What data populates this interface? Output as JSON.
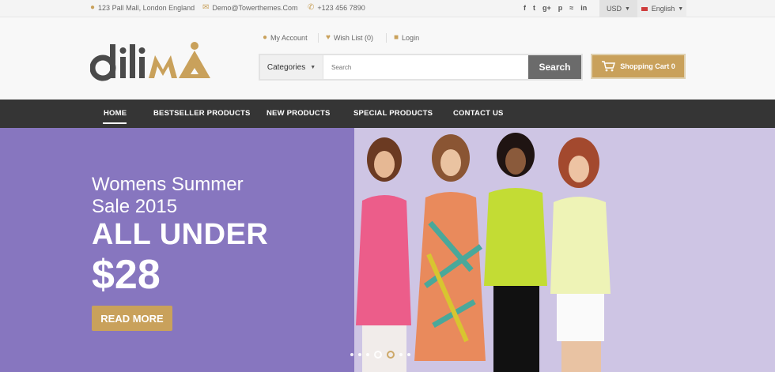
{
  "topbar": {
    "address": "123 Pall Mall, London England",
    "email": "Demo@Towerthemes.Com",
    "phone": "+123 456 7890",
    "social_icons": [
      {
        "icon": "facebook-icon",
        "glyph": "f"
      },
      {
        "icon": "twitter-icon",
        "glyph": "t"
      },
      {
        "icon": "google-plus-icon",
        "glyph": "g+"
      },
      {
        "icon": "pinterest-icon",
        "glyph": "p"
      },
      {
        "icon": "rss-icon",
        "glyph": "≈"
      },
      {
        "icon": "linkedin-icon",
        "glyph": "in"
      }
    ],
    "currency": "USD",
    "language": "English"
  },
  "header": {
    "logo_text": "diliMA",
    "my_account": "My Account",
    "wish_list": "Wish List (0)",
    "login": "Login",
    "categories_label": "Categories",
    "search_placeholder": "Search",
    "search_button": "Search",
    "cart_label": "Shopping Cart 0"
  },
  "nav": {
    "items": [
      "HOME",
      "BESTSELLER PRODUCTS",
      "NEW PRODUCTS",
      "SPECIAL PRODUCTS",
      "CONTACT US"
    ],
    "active": "HOME"
  },
  "hero": {
    "subtitle": "Womens Summer\nSale 2015",
    "headline": "ALL UNDER",
    "price": "$28",
    "button": "READ MORE",
    "slide_count": 7,
    "active_slide": 4
  },
  "colors": {
    "accent": "#c9a15b",
    "nav_bg": "#353535",
    "hero_left": "#8776bf",
    "hero_right": "#cec5e4"
  }
}
